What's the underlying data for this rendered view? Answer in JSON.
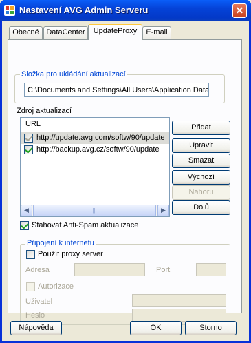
{
  "window": {
    "title": "Nastavení AVG Admin Serveru",
    "close_glyph": "✕"
  },
  "tabs": [
    {
      "label": "Obecné"
    },
    {
      "label": "DataCenter"
    },
    {
      "label": "UpdateProxy",
      "active": true
    },
    {
      "label": "E-mail"
    }
  ],
  "storage": {
    "legend": "Složka pro ukládání aktualizací",
    "path": "C:\\Documents and Settings\\All Users\\Application Data"
  },
  "sources": {
    "label": "Zdroj aktualizací",
    "column": "URL",
    "rows": [
      {
        "url": "http://update.avg.com/softw/90/update",
        "checked": true,
        "selected": true
      },
      {
        "url": "http://backup.avg.cz/softw/90/update",
        "checked": true,
        "selected": false
      }
    ],
    "scroll_grip": "|||",
    "scroll_left": "◀",
    "scroll_right": "▶"
  },
  "side_buttons": {
    "add": "Přidat",
    "edit": "Upravit",
    "delete": "Smazat",
    "default": "Výchozí",
    "up": "Nahoru",
    "down": "Dolů"
  },
  "antispam": {
    "label": "Stahovat Anti-Spam aktualizace",
    "checked": true
  },
  "proxy": {
    "legend": "Připojení k internetu",
    "use_proxy": "Použít proxy server",
    "address_label": "Adresa",
    "port_label": "Port",
    "auth_label": "Autorizace",
    "user_label": "Uživatel",
    "password_label": "Heslo"
  },
  "footer": {
    "help": "Nápověda",
    "ok": "OK",
    "cancel": "Storno"
  },
  "colors": {
    "accent": "#0046d5",
    "titlebar": "#0543d8",
    "tab_highlight": "#ffc83c"
  }
}
